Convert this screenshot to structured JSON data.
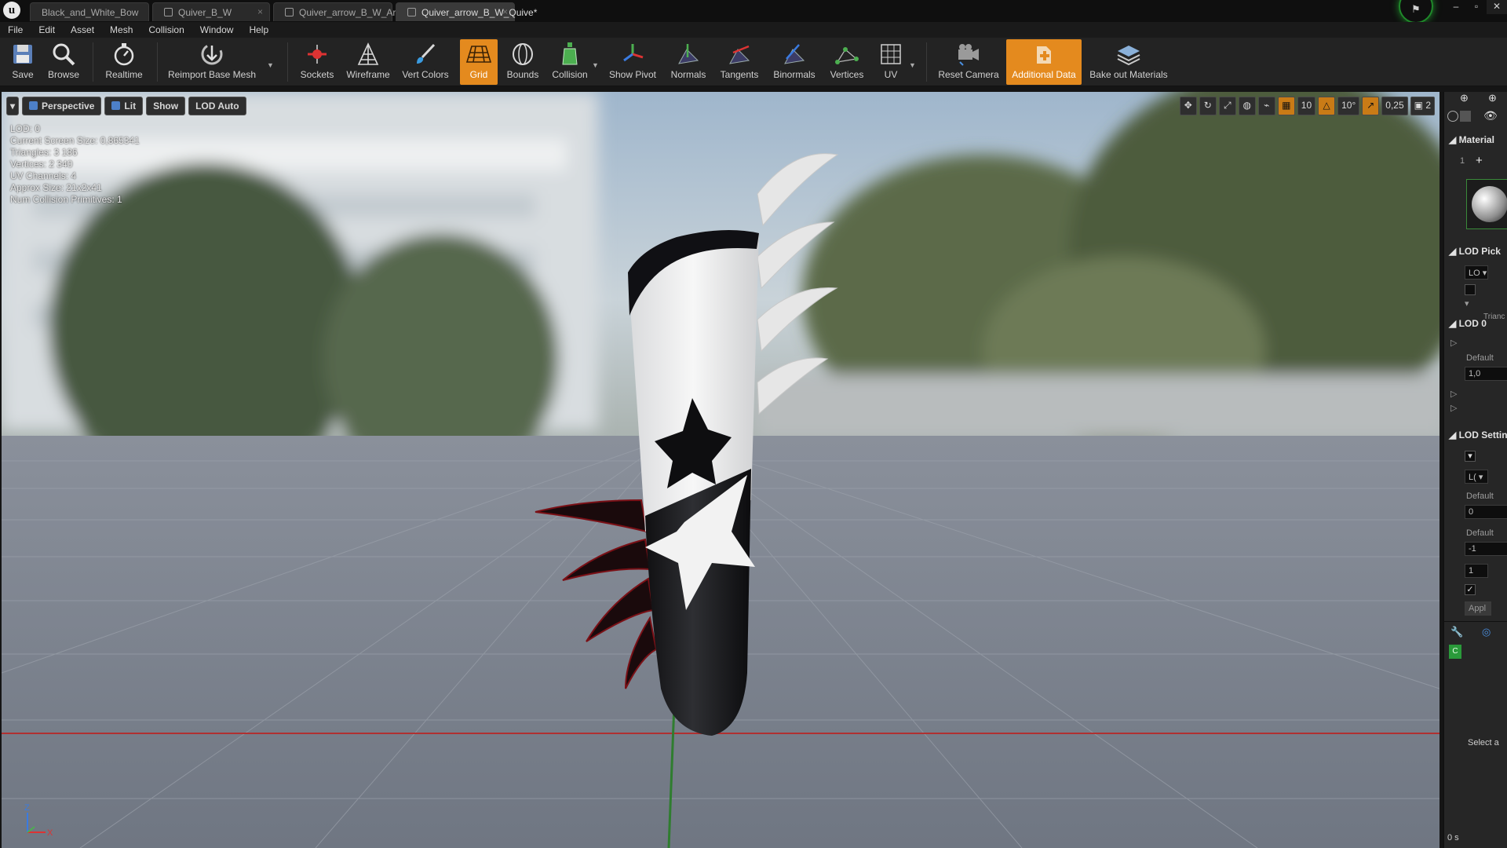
{
  "tabs": [
    {
      "label": "Black_and_White_Bow",
      "active": false
    },
    {
      "label": "Quiver_B_W",
      "active": false
    },
    {
      "label": "Quiver_arrow_B_W_Arrow*",
      "active": false
    },
    {
      "label": "Quiver_arrow_B_W_Quive*",
      "active": true
    }
  ],
  "window_controls": {
    "minimize": "–",
    "maximize": "▫",
    "close": "✕"
  },
  "menu": [
    "File",
    "Edit",
    "Asset",
    "Mesh",
    "Collision",
    "Window",
    "Help"
  ],
  "toolbar": {
    "save": "Save",
    "browse": "Browse",
    "realtime": "Realtime",
    "reimport": "Reimport Base Mesh",
    "sockets": "Sockets",
    "wireframe": "Wireframe",
    "vert_colors": "Vert Colors",
    "grid": "Grid",
    "bounds": "Bounds",
    "collision": "Collision",
    "show_pivot": "Show Pivot",
    "normals": "Normals",
    "tangents": "Tangents",
    "binormals": "Binormals",
    "vertices": "Vertices",
    "uv": "UV",
    "reset_camera": "Reset Camera",
    "additional_data": "Additional Data",
    "bake_out": "Bake out Materials"
  },
  "viewport": {
    "perspective": "Perspective",
    "lit": "Lit",
    "show": "Show",
    "lod": "LOD Auto",
    "grid_snap": "10",
    "rot_snap": "10°",
    "scale_snap": "0,25",
    "camera_speed": "2"
  },
  "stats": {
    "lod": "LOD:  0",
    "screen_size": "Current Screen Size:  0,865341",
    "triangles": "Triangles:  3 186",
    "vertices": "Vertices:  2 340",
    "uv_channels": "UV Channels:  4",
    "approx_size": "Approx Size: 21x2x41",
    "collision": "Num Collision Primitives:  1"
  },
  "axis": {
    "z": "Z",
    "x": "X"
  },
  "details": {
    "material_header": "Material",
    "material_index": "1",
    "lod_picker_header": "LOD Pick",
    "lod_picker_value": "LO",
    "triangles_short": "Trianc",
    "lod0_header": "LOD 0",
    "default_label": "Default",
    "default_value": "1,0",
    "lod_settings_header": "LOD Settin",
    "lod_settings_value": "L(",
    "default_label_2": "Default",
    "default_value_2": "0",
    "default_label_3": "Default",
    "default_value_3": "-1",
    "num_field": "1",
    "apply": "Appl",
    "select_text": "Select a",
    "timer": "0 s",
    "green_badge": "C"
  },
  "colors": {
    "accent_orange": "#e48a1e",
    "toolbar_bg": "#232323",
    "panel_bg": "#262626"
  }
}
